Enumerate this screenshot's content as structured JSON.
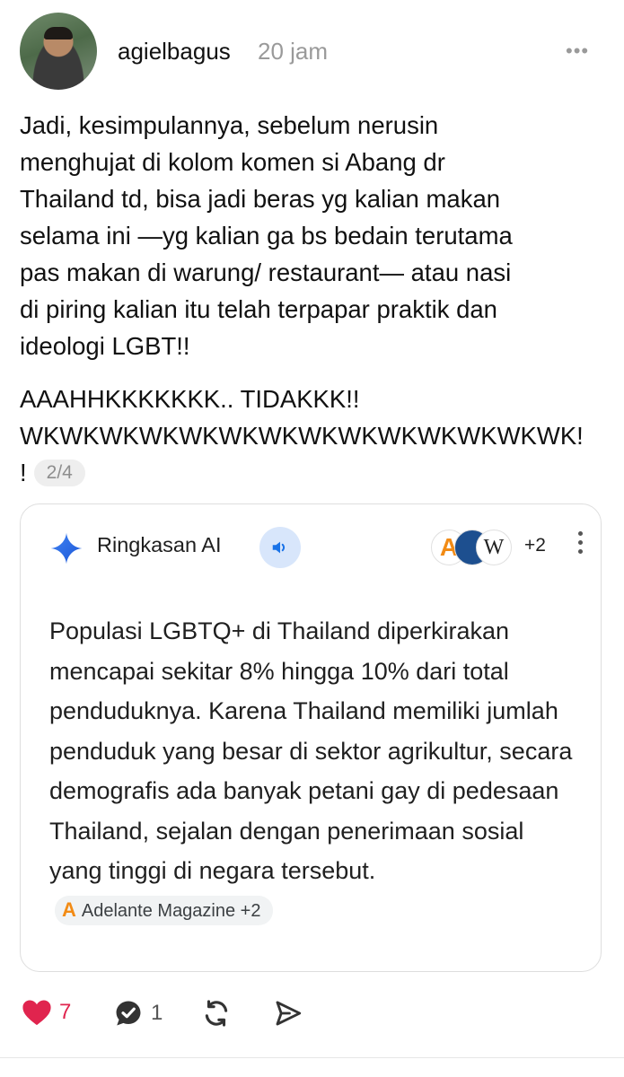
{
  "post": {
    "username": "agielbagus",
    "time": "20 jam",
    "more_label": "•••",
    "paragraph1": [
      "Jadi, kesimpulannya, sebelum nerusin",
      "menghujat di kolom komen si Abang dr",
      "Thailand td, bisa jadi beras yg kalian makan",
      "selama ini —yg kalian ga bs bedain terutama",
      "pas makan di warung/ restaurant— atau nasi",
      "di piring kalian itu telah terpapar praktik dan",
      "ideologi LGBT!!"
    ],
    "paragraph2": [
      "AAAHHKKKKKKK.. TIDAKKK!!",
      "WKWKWKWKWKWKWKWKWKWKWKWKWKWK!",
      "!"
    ],
    "page_indicator": "2/4"
  },
  "ai_card": {
    "title": "Ringkasan AI",
    "source_a_letter": "A",
    "source_c_letter": "W",
    "sources_more": "+2",
    "summary": "Populasi LGBTQ+ di Thailand diperkirakan mencapai sekitar 8% hingga 10% dari total penduduknya. Karena Thailand memiliki jumlah penduduk yang besar di sektor agrikultur, secara demografis ada banyak petani gay di pedesaan Thailand, sejalan dengan penerimaan sosial yang tinggi di negara tersebut.",
    "chip_letter": "A",
    "chip_label": "Adelante Magazine +2"
  },
  "actions": {
    "likes": "7",
    "comments": "1"
  },
  "colors": {
    "like": "#e0244e",
    "accent_blue": "#1a73e8",
    "speaker_bg": "#d8e6fb"
  }
}
